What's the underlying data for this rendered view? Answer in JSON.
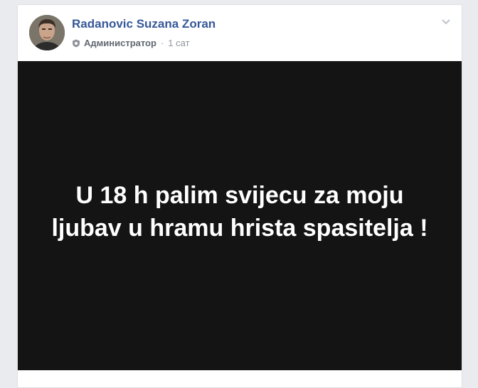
{
  "post": {
    "author_name": "Radanovic Suzana Zoran",
    "role": "Администратор",
    "separator": "·",
    "time": "1 сат",
    "image_text": "U 18 h palim svijecu za moju ljubav u hramu hrista spasitelja !"
  },
  "icons": {
    "role_icon": "shield-icon",
    "menu_icon": "chevron-down-icon"
  },
  "colors": {
    "author": "#365899",
    "meta": "#90949c",
    "image_background": "#141414",
    "image_text": "#ffffff",
    "page_background": "#e9ebee"
  }
}
